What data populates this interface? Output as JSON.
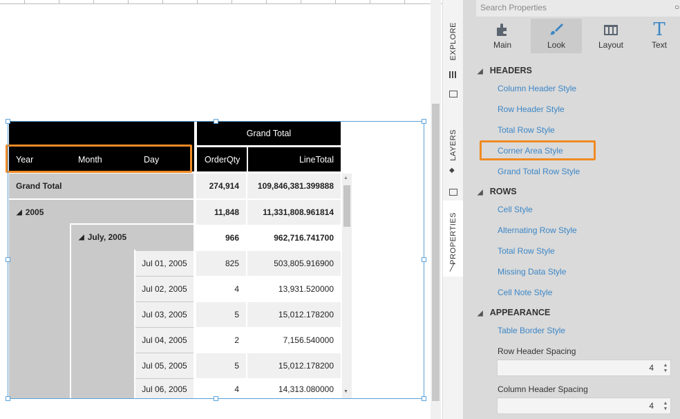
{
  "pivot": {
    "top_header": "Grand Total",
    "row_headers": [
      "Year",
      "Month",
      "Day"
    ],
    "measures": [
      "OrderQty",
      "LineTotal"
    ],
    "grand_total": {
      "label": "Grand Total",
      "qty": "274,914",
      "total": "109,846,381.399888"
    },
    "year": {
      "label": "2005",
      "qty": "11,848",
      "total": "11,331,808.961814"
    },
    "month": {
      "label": "July, 2005",
      "qty": "966",
      "total": "962,716.741700"
    },
    "days": [
      {
        "label": "Jul 01, 2005",
        "qty": "825",
        "total": "503,805.916900"
      },
      {
        "label": "Jul 02, 2005",
        "qty": "4",
        "total": "13,931.520000"
      },
      {
        "label": "Jul 03, 2005",
        "qty": "5",
        "total": "15,012.178200"
      },
      {
        "label": "Jul 04, 2005",
        "qty": "2",
        "total": "7,156.540000"
      },
      {
        "label": "Jul 05, 2005",
        "qty": "5",
        "total": "15,012.178200"
      },
      {
        "label": "Jul 06, 2005",
        "qty": "4",
        "total": "14,313.080000"
      }
    ]
  },
  "tabs": [
    "EXPLORE",
    "LAYERS",
    "PROPERTIES"
  ],
  "panel": {
    "search_placeholder": "Search Properties",
    "toolbar": [
      "Main",
      "Look",
      "Layout",
      "Text"
    ],
    "headers": {
      "title": "HEADERS",
      "items": [
        "Column Header Style",
        "Row Header Style",
        "Total Row Style",
        "Corner Area Style",
        "Grand Total Row Style"
      ]
    },
    "rows": {
      "title": "ROWS",
      "items": [
        "Cell Style",
        "Alternating Row Style",
        "Total Row Style",
        "Missing Data Style",
        "Cell Note Style"
      ]
    },
    "appearance": {
      "title": "APPEARANCE",
      "link": "Table Border Style",
      "row_spacing_label": "Row Header Spacing",
      "row_spacing_value": "4",
      "col_spacing_label": "Column Header Spacing",
      "col_spacing_value": "4"
    }
  },
  "colors": {
    "accent": "#3b86c6",
    "highlight": "#f08a24",
    "selection": "#5aa0d8"
  }
}
